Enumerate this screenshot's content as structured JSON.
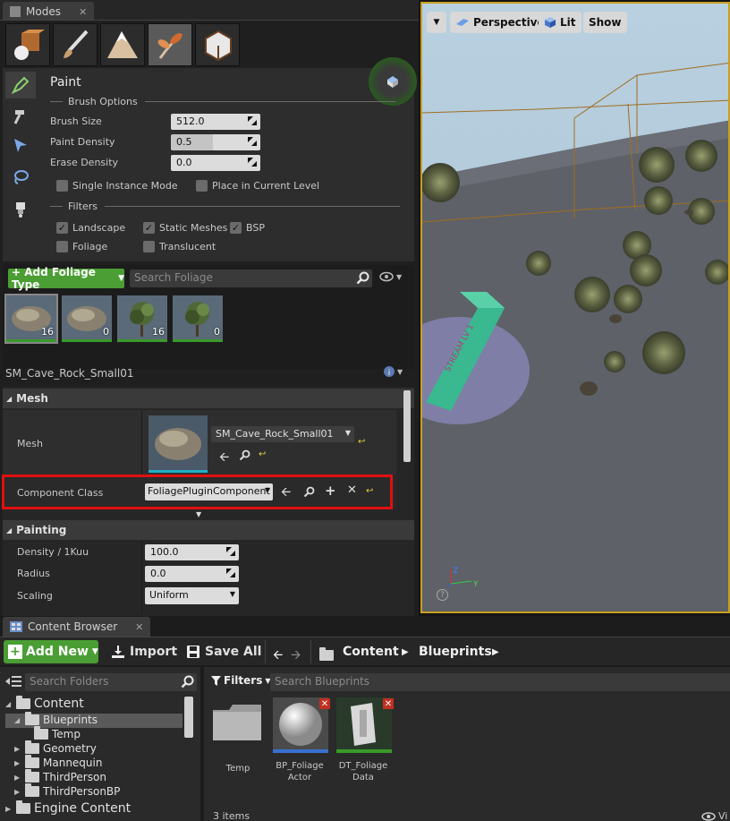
{
  "modes_panel": {
    "tab_label": "Modes",
    "mode_tabs": [
      "place-mode",
      "paint-mode",
      "landscape-mode",
      "foliage-mode",
      "geometry-mode"
    ],
    "title": "Paint",
    "brush_options": {
      "heading": "Brush Options",
      "brush_size_label": "Brush Size",
      "brush_size_value": "512.0",
      "paint_density_label": "Paint Density",
      "paint_density_value": "0.5",
      "erase_density_label": "Erase Density",
      "erase_density_value": "0.0",
      "single_instance_label": "Single Instance Mode",
      "place_current_label": "Place in Current Level"
    },
    "filters": {
      "heading": "Filters",
      "landscape_label": "Landscape",
      "static_meshes_label": "Static Meshes",
      "bsp_label": "BSP",
      "foliage_label": "Foliage",
      "translucent_label": "Translucent"
    },
    "add_foliage_label": "+ Add Foliage Type",
    "search_foliage_placeholder": "Search Foliage",
    "foliage_types": [
      {
        "kind": "rock",
        "count": "16"
      },
      {
        "kind": "rock",
        "count": "0"
      },
      {
        "kind": "tree",
        "count": "16"
      },
      {
        "kind": "tree",
        "count": "0"
      }
    ],
    "selected_name": "SM_Cave_Rock_Small01",
    "mesh_section": {
      "title": "Mesh",
      "mesh_label": "Mesh",
      "mesh_value": "SM_Cave_Rock_Small01",
      "component_class_label": "Component Class",
      "component_class_value": "FoliagePluginComponent"
    },
    "painting_section": {
      "title": "Painting",
      "density_label": "Density / 1Kuu",
      "density_value": "100.0",
      "radius_label": "Radius",
      "radius_value": "0.0",
      "scaling_label": "Scaling",
      "scaling_value": "Uniform"
    }
  },
  "viewport": {
    "perspective_label": "Perspective",
    "lit_label": "Lit",
    "show_label": "Show",
    "volume_label": "STREAM LV 1",
    "axis_z": "Z",
    "axis_y": "Y"
  },
  "content_browser": {
    "tab_label": "Content Browser",
    "add_new_label": "Add New",
    "import_label": "Import",
    "save_all_label": "Save All",
    "path": [
      "Content",
      "Blueprints"
    ],
    "search_folders_placeholder": "Search Folders",
    "filters_label": "Filters",
    "search_assets_placeholder": "Search Blueprints",
    "tree": [
      {
        "label": "Content",
        "level": 0
      },
      {
        "label": "Blueprints",
        "level": 1
      },
      {
        "label": "Temp",
        "level": 2
      },
      {
        "label": "Geometry",
        "level": 1
      },
      {
        "label": "Mannequin",
        "level": 1
      },
      {
        "label": "ThirdPerson",
        "level": 1
      },
      {
        "label": "ThirdPersonBP",
        "level": 1
      },
      {
        "label": "Engine Content",
        "level": 0
      }
    ],
    "assets": [
      {
        "line1": "Temp",
        "line2": ""
      },
      {
        "line1": "BP_Foliage",
        "line2": "Actor"
      },
      {
        "line1": "DT_Foliage",
        "line2": "Data"
      }
    ],
    "item_count": "3 items",
    "view_options_label": "Vi"
  },
  "colors": {
    "accent_green": "#4a9e34",
    "highlight_red": "#e01010",
    "volume_green": "#22c07a",
    "foliage_bar": "#3a9a2a"
  }
}
